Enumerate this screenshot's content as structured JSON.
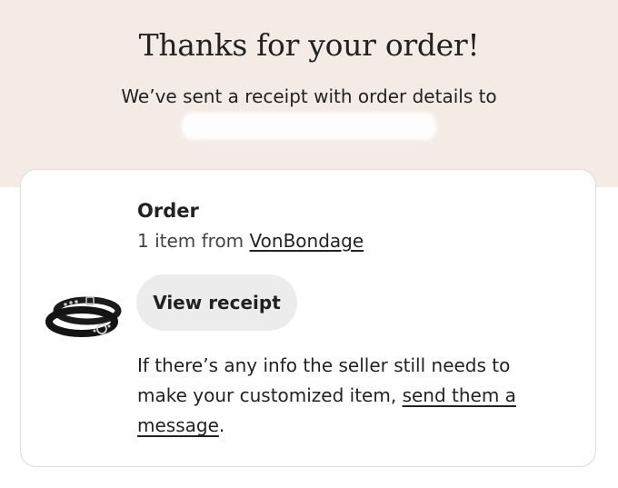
{
  "hero": {
    "title": "Thanks for your order!",
    "subtitle": "We’ve sent a receipt with order details to",
    "background_color": "#f4ebe7"
  },
  "order": {
    "heading": "Order",
    "items_prefix": "1 item from ",
    "shop_name": "VonBondage",
    "view_receipt_label": "View receipt",
    "thumbnail_icon": "leather-bracelets-product-image",
    "info_text_before_link": "If there’s any info the seller still needs to make your customized item, ",
    "info_link_text": "send them a message",
    "info_text_after_link": "."
  },
  "colors": {
    "text": "#222222",
    "secondary_text": "#444444",
    "button_bg": "#ececec",
    "card_border": "#dddddd"
  }
}
